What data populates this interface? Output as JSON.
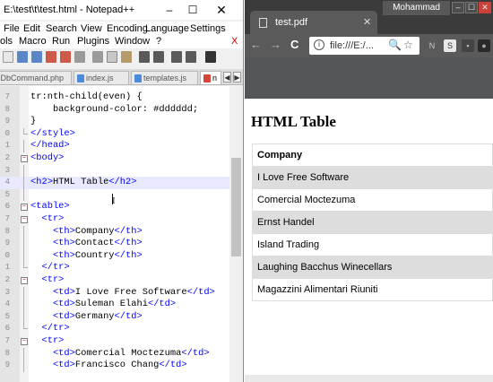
{
  "notepad": {
    "title": "E:\\test\\t\\test.html - Notepad++",
    "window_controls": {
      "minimize": "–",
      "maximize": "☐",
      "close": "✕"
    },
    "menu": [
      "File",
      "Edit",
      "Search",
      "View",
      "Encoding",
      "Language",
      "Settings",
      "ols",
      "Macro",
      "Run",
      "Plugins",
      "Window",
      "?"
    ],
    "close_x": "X",
    "tabs": [
      "CDbCommand.php",
      "index.js",
      "templates.js",
      "n"
    ],
    "tab_scroll": {
      "left": "◀",
      "right": "▶"
    },
    "code_lines": [
      {
        "num": "7",
        "segs": [
          {
            "t": "tr:nth-child(even) {",
            "c": "ft"
          }
        ]
      },
      {
        "num": "8",
        "segs": [
          {
            "t": "    background-color: #dddddd;",
            "c": "ft"
          }
        ]
      },
      {
        "num": "9",
        "segs": [
          {
            "t": "}",
            "c": "ft"
          }
        ]
      },
      {
        "num": "0",
        "segs": [
          {
            "t": "</style>",
            "c": "tg"
          }
        ]
      },
      {
        "num": "1",
        "segs": [
          {
            "t": "</head>",
            "c": "tg"
          }
        ]
      },
      {
        "num": "2",
        "segs": [
          {
            "t": "<body>",
            "c": "tg"
          }
        ]
      },
      {
        "num": "3",
        "segs": []
      },
      {
        "num": "4",
        "segs": [
          {
            "t": "<h2>",
            "c": "tg"
          },
          {
            "t": "HTML Table",
            "c": "ft"
          },
          {
            "t": "</h2>",
            "c": "tg"
          }
        ]
      },
      {
        "num": "5",
        "segs": []
      },
      {
        "num": "6",
        "segs": [
          {
            "t": "<table>",
            "c": "tg"
          }
        ]
      },
      {
        "num": "7",
        "segs": [
          {
            "t": "  <tr>",
            "c": "tg"
          }
        ]
      },
      {
        "num": "8",
        "segs": [
          {
            "t": "    <th>",
            "c": "tg"
          },
          {
            "t": "Company",
            "c": "ft"
          },
          {
            "t": "</th>",
            "c": "tg"
          }
        ]
      },
      {
        "num": "9",
        "segs": [
          {
            "t": "    <th>",
            "c": "tg"
          },
          {
            "t": "Contact",
            "c": "ft"
          },
          {
            "t": "</th>",
            "c": "tg"
          }
        ]
      },
      {
        "num": "0",
        "segs": [
          {
            "t": "    <th>",
            "c": "tg"
          },
          {
            "t": "Country",
            "c": "ft"
          },
          {
            "t": "</th>",
            "c": "tg"
          }
        ]
      },
      {
        "num": "1",
        "segs": [
          {
            "t": "  </tr>",
            "c": "tg"
          }
        ]
      },
      {
        "num": "2",
        "segs": [
          {
            "t": "  <tr>",
            "c": "tg"
          }
        ]
      },
      {
        "num": "3",
        "segs": [
          {
            "t": "    <td>",
            "c": "tg"
          },
          {
            "t": "I Love Free Software",
            "c": "ft"
          },
          {
            "t": "</td>",
            "c": "tg"
          }
        ]
      },
      {
        "num": "4",
        "segs": [
          {
            "t": "    <td>",
            "c": "tg"
          },
          {
            "t": "Suleman Elahi",
            "c": "ft"
          },
          {
            "t": "</td>",
            "c": "tg"
          }
        ]
      },
      {
        "num": "5",
        "segs": [
          {
            "t": "    <td>",
            "c": "tg"
          },
          {
            "t": "Germany",
            "c": "ft"
          },
          {
            "t": "</td>",
            "c": "tg"
          }
        ]
      },
      {
        "num": "6",
        "segs": [
          {
            "t": "  </tr>",
            "c": "tg"
          }
        ]
      },
      {
        "num": "7",
        "segs": [
          {
            "t": "  <tr>",
            "c": "tg"
          }
        ]
      },
      {
        "num": "8",
        "segs": [
          {
            "t": "    <td>",
            "c": "tg"
          },
          {
            "t": "Comercial Moctezuma",
            "c": "ft"
          },
          {
            "t": "</td>",
            "c": "tg"
          }
        ]
      },
      {
        "num": "9",
        "segs": [
          {
            "t": "    <td>",
            "c": "tg"
          },
          {
            "t": "Francisco Chang",
            "c": "ft"
          },
          {
            "t": "</td>",
            "c": "tg"
          }
        ]
      }
    ]
  },
  "chrome": {
    "tab_title": "test.pdf",
    "tab_close": "✕",
    "user": "Mohammad",
    "window_controls": {
      "minimize": "–",
      "maximize": "☐",
      "close": "✕"
    },
    "url": "file:///E:/...",
    "info_icon": "i",
    "nav": {
      "back": "←",
      "forward": "→",
      "reload": "C"
    },
    "omnibox_icons": {
      "zoom": "🔍",
      "star": "☆"
    },
    "extensions": [
      {
        "name": "n-extension-icon",
        "glyph": "N",
        "bg": "#5a5a5a",
        "fg": "#ccc"
      },
      {
        "name": "s-extension-icon",
        "glyph": "S",
        "bg": "#e8e8e8",
        "fg": "#333"
      },
      {
        "name": "grey-extension-icon",
        "glyph": "▪",
        "bg": "#444",
        "fg": "#bbb"
      },
      {
        "name": "green-extension-icon",
        "glyph": "●",
        "bg": "#2a2a2a",
        "fg": "#aaa"
      }
    ]
  },
  "pdf": {
    "heading": "HTML Table",
    "header": "Company",
    "rows": [
      "I Love Free Software",
      "Comercial Moctezuma",
      "Ernst Handel",
      "Island Trading",
      "Laughing Bacchus Winecellars",
      "Magazzini Alimentari Riuniti"
    ]
  }
}
